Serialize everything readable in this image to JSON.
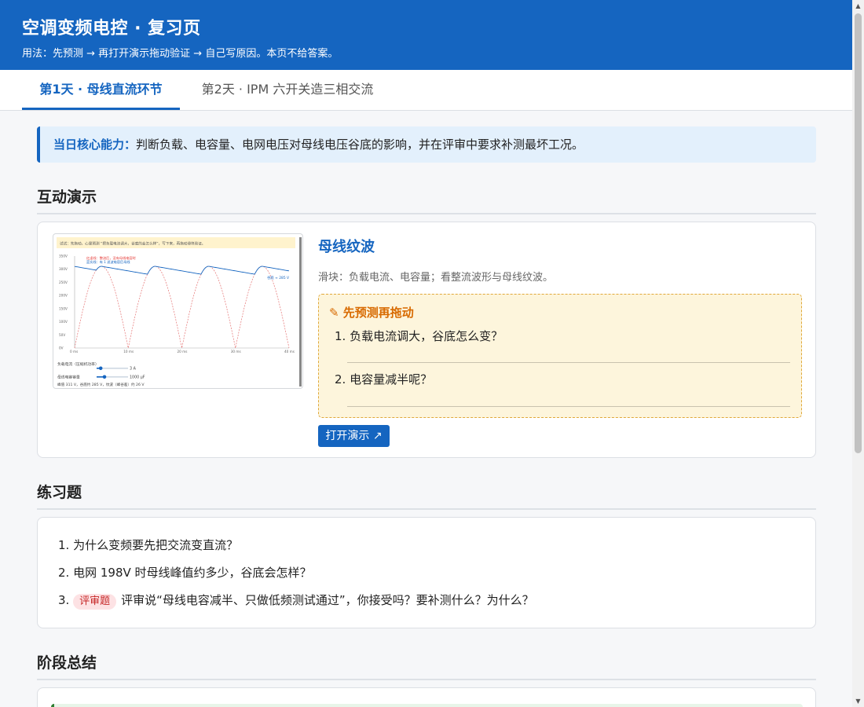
{
  "header": {
    "title": "空调变频电控 · 复习页",
    "subtitle": "用法：先预测 → 再打开演示拖动验证 → 自己写原因。本页不给答案。"
  },
  "tabs": [
    {
      "label": "第1天 · 母线直流环节",
      "active": true
    },
    {
      "label": "第2天 · IPM 六开关造三相交流",
      "active": false
    }
  ],
  "callout": {
    "label": "当日核心能力：",
    "text": "判断负载、电容量、电网电压对母线电压谷底的影响，并在评审中要求补测最坏工况。"
  },
  "sections": {
    "demo": "互动演示",
    "exercises": "练习题",
    "summary": "阶段总结"
  },
  "demo": {
    "title": "母线纹波",
    "description": "滑块：负载电流、电容量；看整流波形与母线纹波。",
    "predict_heading": "✎ 先预测再拖动",
    "questions": [
      "1. 负载电流调大，谷底怎么变？",
      "2. 电容量减半呢？"
    ],
    "open_button": "打开演示 ↗",
    "thumbnail": {
      "note": "试试：先拖动。心里预测 “把负载电流调大，谷底的会怎么样”，写下来，再拖动滑块验证。",
      "y_ticks": [
        "350V",
        "300V",
        "250V",
        "200V",
        "150V",
        "100V",
        "50V",
        "0V"
      ],
      "x_ticks": [
        "0 ms",
        "10 ms",
        "20 ms",
        "30 ms",
        "40 ms"
      ],
      "legend": [
        "红虚线：整流后，没有母线电容时",
        "蓝实线：有 1 滤波电容后母线"
      ],
      "marker": "谷底 ≈ 285 V",
      "slider1_label": "负载电流（压缩机功率）",
      "slider1_value": "3 A",
      "slider2_label": "母线电容容量",
      "slider2_value": "1000 μF",
      "readout": "峰值 311 V，谷底约 285 V，纹波（峰谷差）约 26 V",
      "load_fraction": 0.13,
      "cap_fraction": 0.25
    }
  },
  "exercises": [
    {
      "num": "1.",
      "badge": "",
      "text": "为什么变频要先把交流变直流？"
    },
    {
      "num": "2.",
      "badge": "",
      "text": "电网 198V 时母线峰值约多少，谷底会怎样？"
    },
    {
      "num": "3.",
      "badge": "评审题",
      "text": "评审说“母线电容减半、只做低频测试通过”，你接受吗？要补测什么？为什么？"
    }
  ],
  "colors": {
    "primary": "#1565c0",
    "warn": "#d86a00",
    "badge": "#c62828"
  }
}
